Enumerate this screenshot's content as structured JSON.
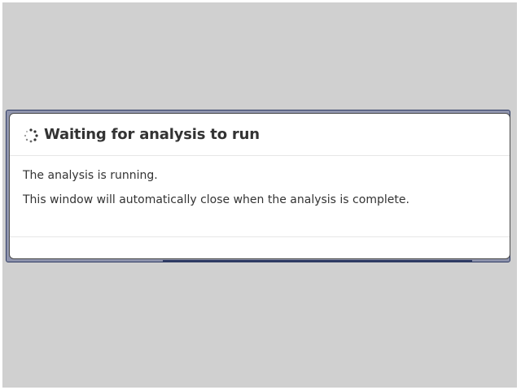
{
  "modal": {
    "title": "Waiting for analysis to run",
    "icon": "spinner-icon",
    "body": [
      "The analysis is running.",
      "This window will automatically close when the analysis is complete."
    ]
  },
  "colors": {
    "backdrop": "#d0d0d0",
    "modal_border": "#2e3a63",
    "text": "#333333"
  }
}
